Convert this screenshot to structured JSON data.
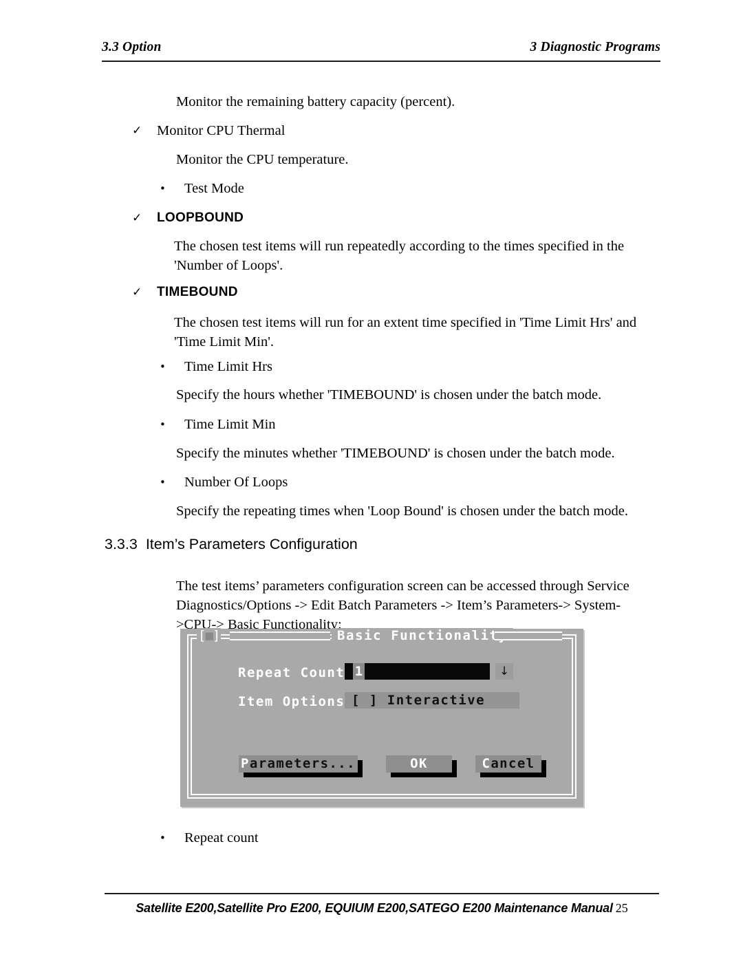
{
  "header": {
    "left": "3.3 Option",
    "right": "3  Diagnostic Programs"
  },
  "body": {
    "battery_note": "Monitor the remaining battery capacity (percent).",
    "item_monitor_cpu_thermal": "Monitor CPU Thermal",
    "cpu_temp_note": "Monitor the CPU temperature.",
    "item_test_mode": "Test Mode",
    "item_loopbound": "LOOPBOUND",
    "loopbound_desc": "The chosen test items will run repeatedly according to the times specified in the 'Number of Loops'.",
    "item_timebound": "TIMEBOUND",
    "timebound_desc": "The chosen test items will run for an extent time specified in 'Time Limit Hrs' and 'Time Limit Min'.",
    "item_time_limit_hrs": "Time Limit Hrs",
    "time_limit_hrs_desc": "Specify the hours whether 'TIMEBOUND' is chosen under the batch mode.",
    "item_time_limit_min": "Time Limit Min",
    "time_limit_min_desc": "Specify the minutes whether 'TIMEBOUND' is chosen under the batch mode.",
    "item_number_of_loops": "Number Of Loops",
    "number_of_loops_desc": "Specify the repeating times when 'Loop Bound' is chosen under the batch mode.",
    "item_repeat_count": "Repeat count",
    "bullet_check": "✓",
    "bullet_dot": "•"
  },
  "section": {
    "number": "3.3.3",
    "title": "Item’s Parameters Configuration",
    "intro": "The test items’ parameters configuration screen can be accessed through Service Diagnostics/Options -> Edit Batch Parameters -> Item’s Parameters-> System->CPU-> Basic Functionality:"
  },
  "dialog": {
    "title": "Basic Functionality",
    "close_glyph": "[■]",
    "repeat_count_label": "Repeat Count:",
    "repeat_count_value": "1",
    "dropdown_glyph": "↓",
    "item_options_label": "Item Options:",
    "item_options_value": "[ ] Interactive",
    "buttons": {
      "parameters_accel": "P",
      "parameters_rest": "arameters...",
      "ok": "OK",
      "cancel_accel": "C",
      "cancel_rest": "ancel"
    },
    "colors": {
      "panel": "#a9a9a9",
      "field": "#0a0a0a",
      "button": "#8f8f8f",
      "border": "#ffffff"
    }
  },
  "footer": {
    "manual": "Satellite E200,Satellite Pro E200, EQUIUM E200,SATEGO E200 Maintenance Manual",
    "page": "25"
  }
}
